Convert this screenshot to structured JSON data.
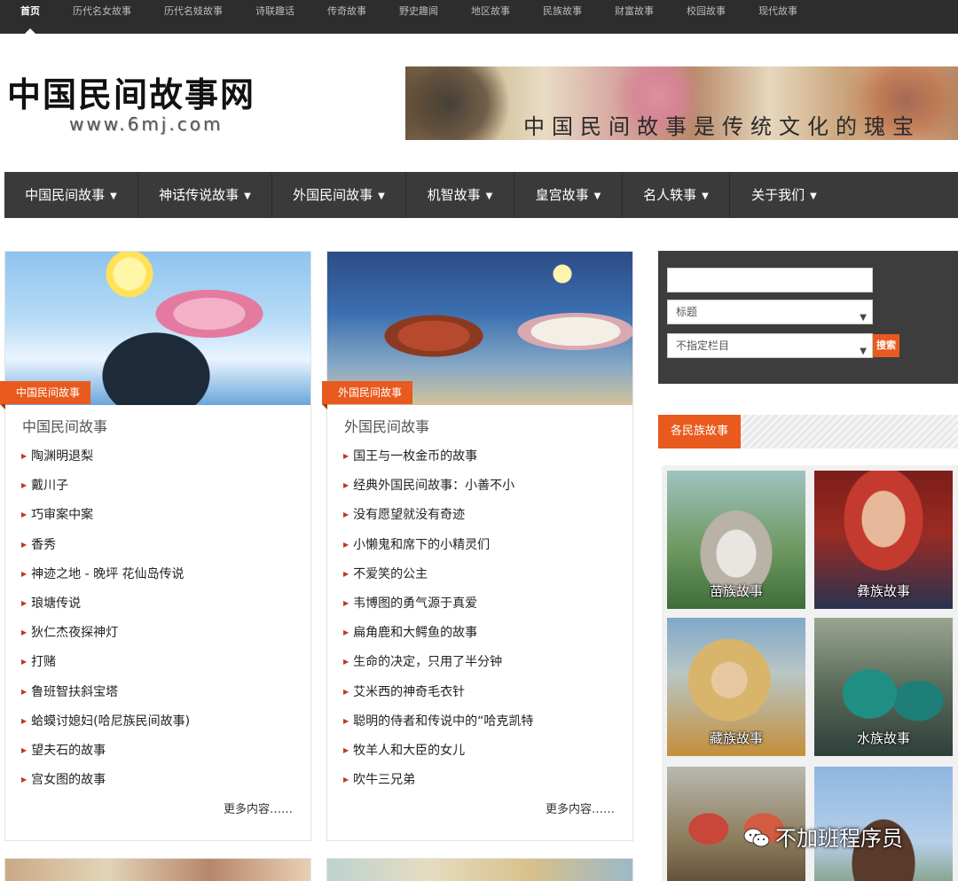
{
  "topnav": [
    {
      "label": "首页",
      "active": true
    },
    {
      "label": "历代名女故事"
    },
    {
      "label": "历代名妓故事"
    },
    {
      "label": "诗联趣话"
    },
    {
      "label": "传奇故事"
    },
    {
      "label": "野史趣闻"
    },
    {
      "label": "地区故事"
    },
    {
      "label": "民族故事"
    },
    {
      "label": "财富故事"
    },
    {
      "label": "校园故事"
    },
    {
      "label": "现代故事"
    }
  ],
  "header": {
    "logo_title": "中国民间故事网",
    "logo_url": "www.6mj.com",
    "banner_text": "中国民间故事是传统文化的瑰宝"
  },
  "mainnav": [
    {
      "label": "中国民间故事"
    },
    {
      "label": "神话传说故事"
    },
    {
      "label": "外国民间故事"
    },
    {
      "label": "机智故事"
    },
    {
      "label": "皇宫故事"
    },
    {
      "label": "名人轶事"
    },
    {
      "label": "关于我们"
    }
  ],
  "cards": [
    {
      "tag": "中国民间故事",
      "title": "中国民间故事",
      "items": [
        "陶渊明退梨",
        "戴川子",
        "巧审案中案",
        "香秀",
        "神迹之地 - 晚坪 花仙岛传说",
        "琅塘传说",
        "狄仁杰夜探神灯",
        "打赌",
        "鲁班智扶斜宝塔",
        "蛤蟆讨媳妇(哈尼族民间故事)",
        "望夫石的故事",
        "宫女图的故事"
      ],
      "more": "更多内容……"
    },
    {
      "tag": "外国民间故事",
      "title": "外国民间故事",
      "items": [
        "国王与一枚金币的故事",
        "经典外国民间故事：小善不小",
        "没有愿望就没有奇迹",
        "小懒鬼和席下的小精灵们",
        "不爱笑的公主",
        "韦博图的勇气源于真爱",
        "扁角鹿和大鳄鱼的故事",
        "生命的决定，只用了半分钟",
        "艾米西的神奇毛衣针",
        "聪明的侍者和传说中的“哈克凯特",
        "牧羊人和大臣的女儿",
        "吹牛三兄弟"
      ],
      "more": "更多内容……"
    }
  ],
  "search": {
    "input_value": "",
    "field_select": "标题",
    "column_select": "不指定栏目",
    "button": "搜索"
  },
  "sidebar": {
    "section_title": "各民族故事",
    "thumbs": [
      {
        "label": "苗族故事"
      },
      {
        "label": "彝族故事"
      },
      {
        "label": "藏族故事"
      },
      {
        "label": "水族故事"
      },
      {
        "label": ""
      },
      {
        "label": ""
      }
    ]
  },
  "watermark": "不加班程序员",
  "colors": {
    "accent": "#e85a1d",
    "nav_bg": "#3a3a3a",
    "topbar_bg": "#2d2d2d"
  }
}
